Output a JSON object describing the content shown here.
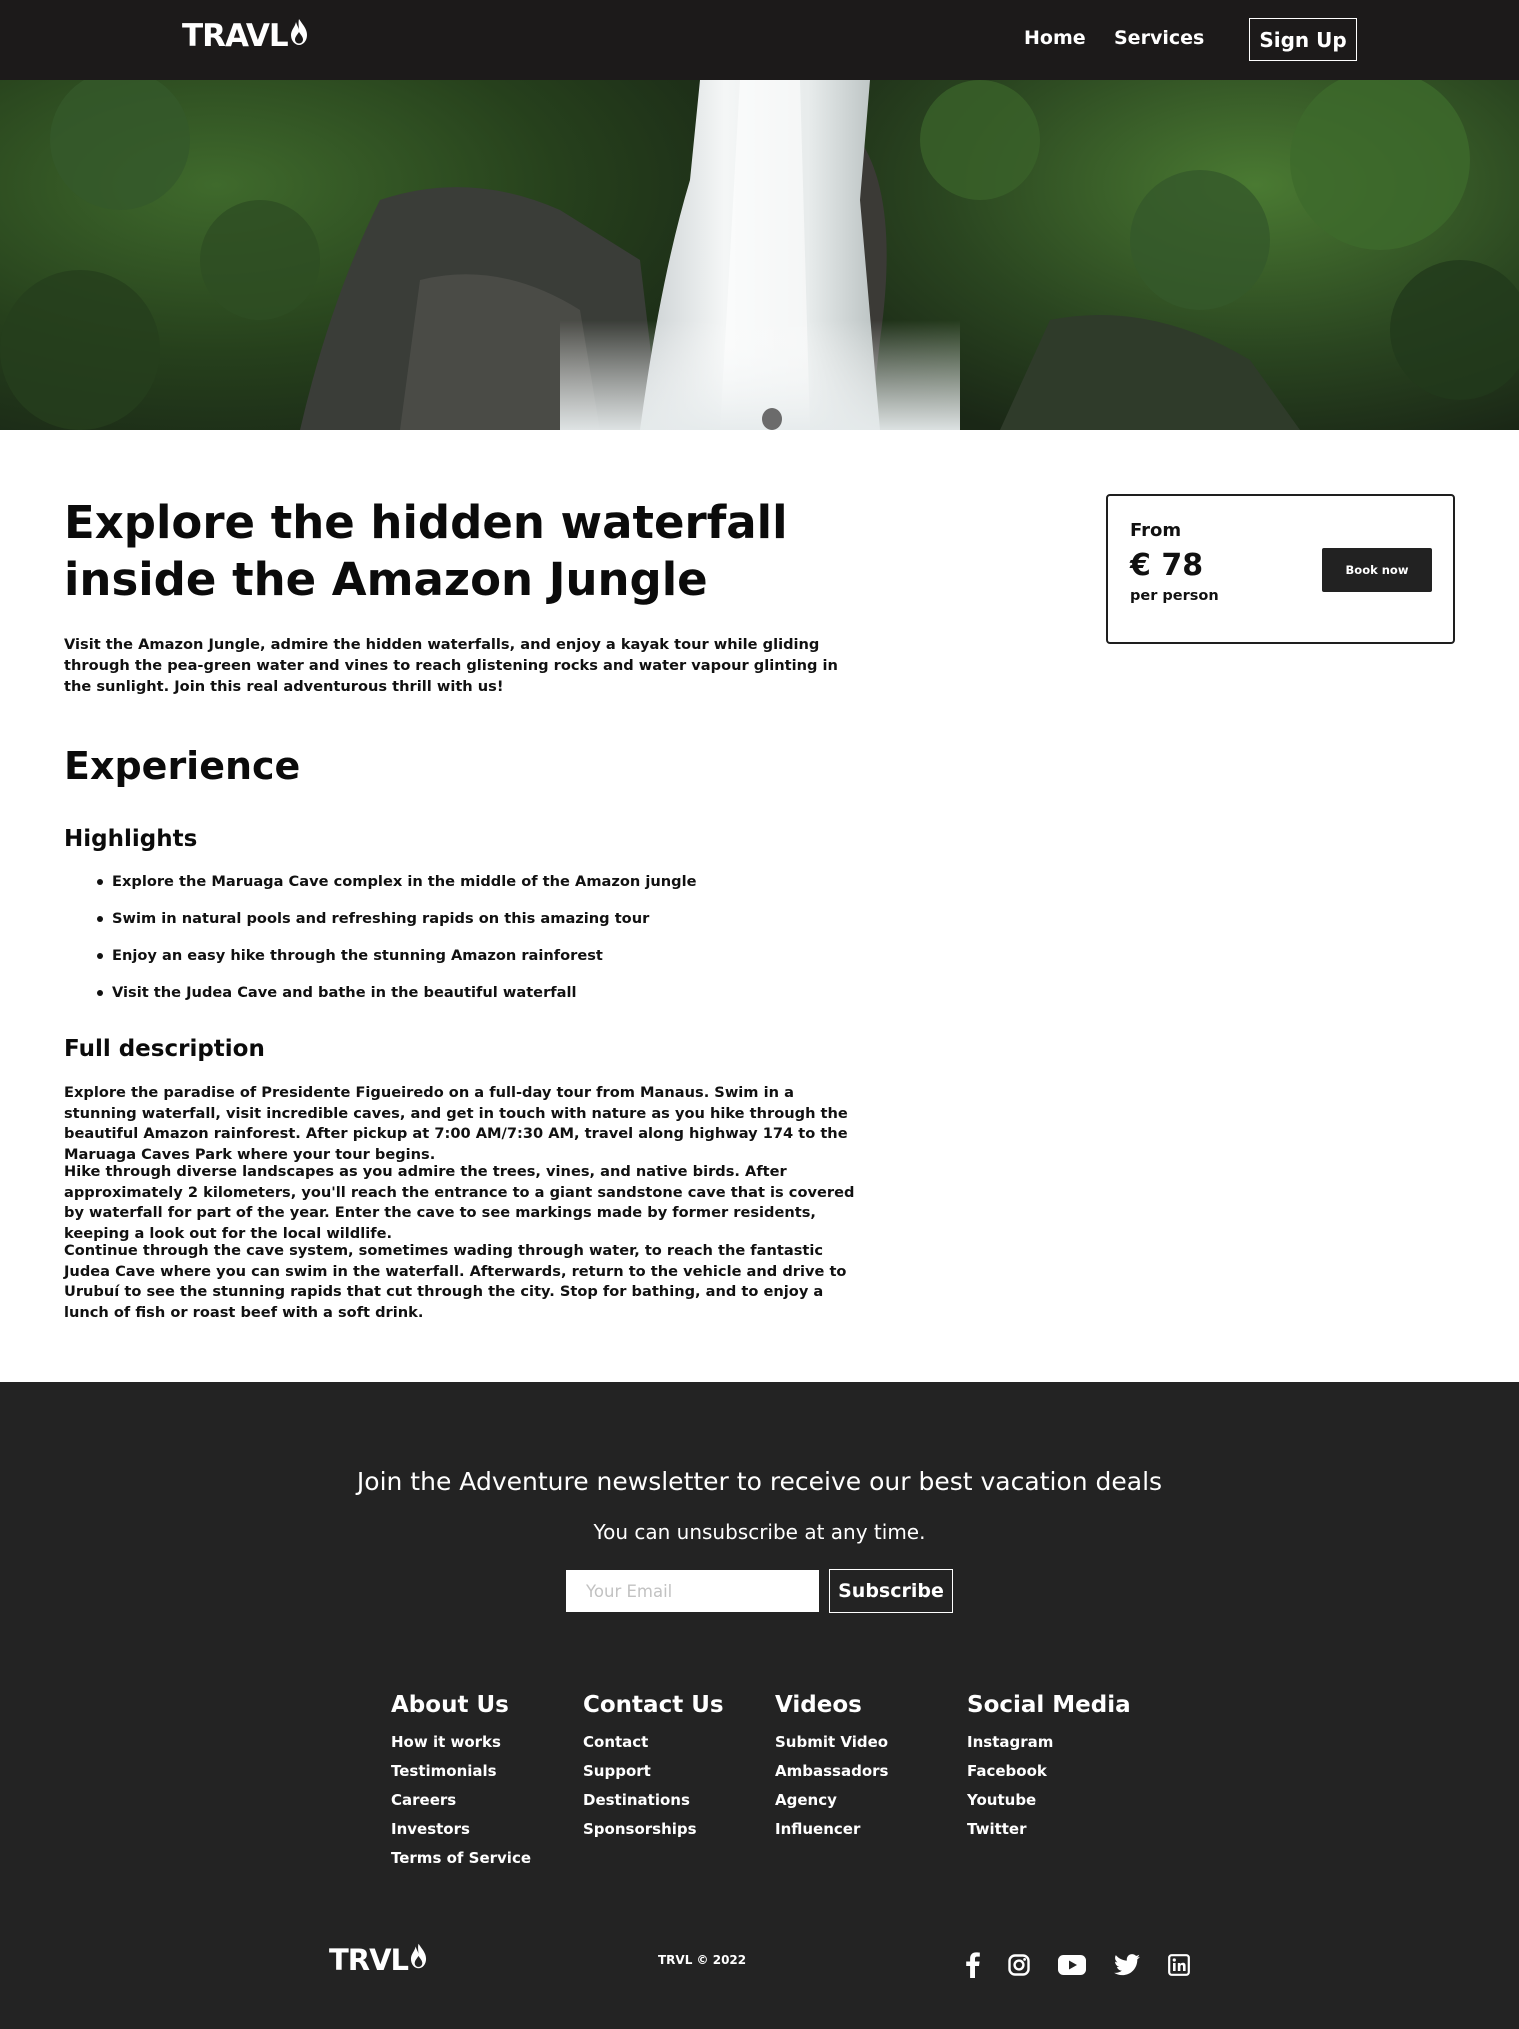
{
  "navbar": {
    "logo_text": "TRAVL",
    "logo_icon": "flame-icon",
    "links": [
      "Home",
      "Services"
    ],
    "signup_label": "Sign Up"
  },
  "hero": {
    "image": "waterfall-jungle-photo"
  },
  "tour": {
    "title": "Explore the hidden waterfall inside the Amazon Jungle",
    "intro": "Visit the Amazon Jungle, admire the hidden waterfalls, and enjoy a kayak tour while gliding through the pea-green water and vines to reach glistening rocks and water vapour glinting in the sunlight. Join this real adventurous thrill with us!",
    "experience_heading": "Experience",
    "highlights_heading": "Highlights",
    "highlights": [
      "Explore the Maruaga Cave complex in the middle of the Amazon jungle",
      "Swim in natural pools and refreshing rapids on this amazing tour",
      "Enjoy an easy hike through the stunning Amazon rainforest",
      "Visit the Judea Cave and bathe in the beautiful waterfall"
    ],
    "full_description_heading": "Full description",
    "full_description": [
      "Explore the paradise of Presidente Figueiredo on a full-day tour from Manaus. Swim in a stunning waterfall, visit incredible caves, and get in touch with nature as you hike through the beautiful Amazon rainforest. After pickup at 7:00 AM/7:30 AM, travel along highway 174 to the Maruaga Caves Park where your tour begins.",
      "Hike through diverse landscapes as you admire the trees, vines, and native birds. After approximately 2 kilometers, you'll reach the entrance to a giant sandstone cave that is covered by waterfall for part of the year. Enter the cave to see markings made by former residents, keeping a look out for the local wildlife.",
      "Continue through the cave system, sometimes wading through water, to reach the fantastic Judea Cave where you can swim in the waterfall. Afterwards, return to the vehicle and drive to Urubuí to see the stunning rapids that cut through the city. Stop for bathing, and to enjoy a lunch of fish or roast beef with a soft drink."
    ]
  },
  "price_card": {
    "from_label": "From",
    "amount": "€ 78",
    "per_label": "per person",
    "book_label": "Book now"
  },
  "newsletter": {
    "title": "Join the Adventure newsletter to receive our best vacation deals",
    "subtitle": "You can unsubscribe at any time.",
    "email_placeholder": "Your Email",
    "subscribe_label": "Subscribe"
  },
  "footer": {
    "columns": [
      {
        "heading": "About Us",
        "links": [
          "How it works",
          "Testimonials",
          "Careers",
          "Investors",
          "Terms of Service"
        ]
      },
      {
        "heading": "Contact Us",
        "links": [
          "Contact",
          "Support",
          "Destinations",
          "Sponsorships"
        ]
      },
      {
        "heading": "Videos",
        "links": [
          "Submit Video",
          "Ambassadors",
          "Agency",
          "Influencer"
        ]
      },
      {
        "heading": "Social Media",
        "links": [
          "Instagram",
          "Facebook",
          "Youtube",
          "Twitter"
        ]
      }
    ],
    "logo_text": "TRVL",
    "copyright": "TRVL © 2022",
    "social_icons": [
      "facebook-icon",
      "instagram-icon",
      "youtube-icon",
      "twitter-icon",
      "linkedin-icon"
    ]
  },
  "colors": {
    "navbar_bg": "#1c1a1a",
    "footer_bg": "#232323",
    "button_dark": "#222222",
    "text": "#111111"
  }
}
